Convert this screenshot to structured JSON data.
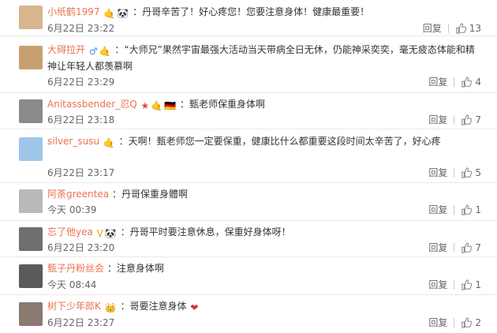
{
  "reply_label": "回复",
  "comments": [
    {
      "name": "小纸鹤1997",
      "text": "：丹哥辛苦了！好心疼您！您要注意身体！健康最重要！",
      "time": "6月22日 23:22",
      "likes": "13",
      "avatar_color": "#d8b58c"
    },
    {
      "name": "大碍拉开",
      "text": "：“大师兄”果然宇宙最强大活动当天带病全日无休，仍能神采奕奕，毫无疲态体能和精神让年轻人都羡慕啊",
      "time": "6月22日 23:29",
      "likes": "4",
      "avatar_color": "#c8a070"
    },
    {
      "name": "Anitassbender_忍Q",
      "text": "：甄老师保重身体啊",
      "time": "6月22日 23:18",
      "likes": "7",
      "avatar_color": "#8a8a8a"
    },
    {
      "name": "silver_susu",
      "text": "：天啊！甄老师您一定要保重，健康比什么都重要这段时间太辛苦了，好心疼",
      "time": "6月22日 23:17",
      "likes": "5",
      "avatar_color": "#9fc6e8"
    },
    {
      "name": "阿荼greentea",
      "text": "：丹哥保重身體啊",
      "time": "今天 00:39",
      "likes": "1",
      "avatar_color": "#b9b9b9"
    },
    {
      "name": "忘了他yea",
      "text": "：丹哥平时要注意休息，保重好身体呀！",
      "time": "6月22日 23:20",
      "likes": "7",
      "avatar_color": "#6f6f6f"
    },
    {
      "name": "甄子丹粉丝会",
      "text": "：注意身体啊",
      "time": "今天 08:44",
      "likes": "1",
      "avatar_color": "#5a5a5a"
    },
    {
      "name": "树下少年郎K",
      "text": "：哥要注意身体",
      "time": "6月22日 23:27",
      "likes": "2",
      "avatar_color": "#8a7a70"
    }
  ]
}
